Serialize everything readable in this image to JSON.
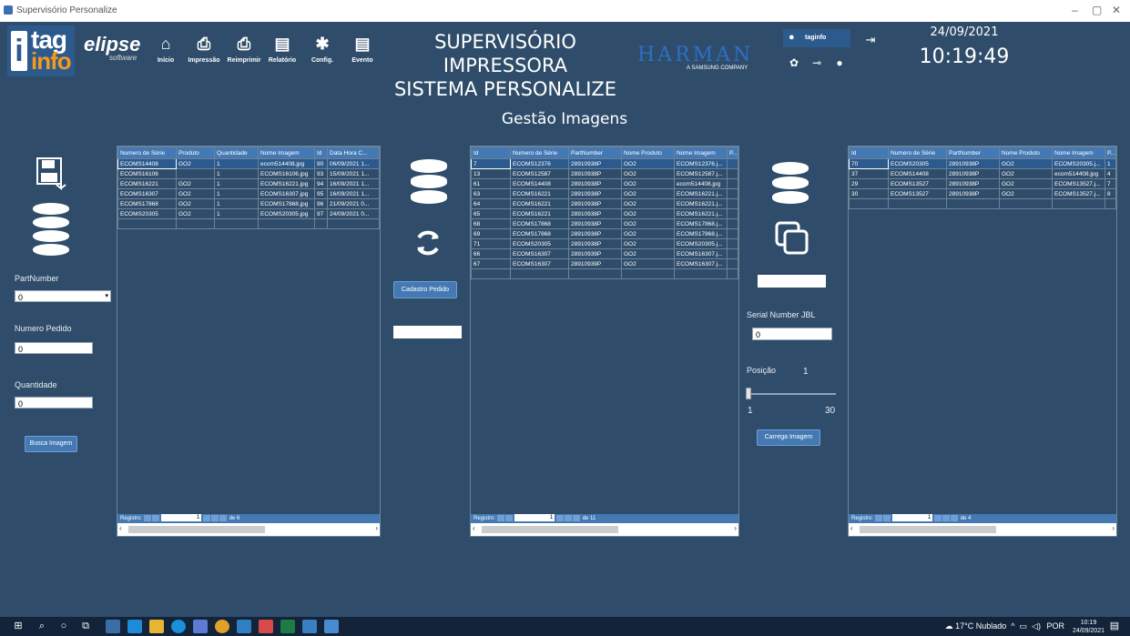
{
  "window": {
    "title": "Supervisório Personalize",
    "min": "–",
    "max": "▢",
    "close": "✕"
  },
  "nav": [
    {
      "label": "Início",
      "icon": "home-icon",
      "glyph": "⌂"
    },
    {
      "label": "Impressão",
      "icon": "printer-icon",
      "glyph": "⎙"
    },
    {
      "label": "Reimprimir",
      "icon": "reprint-icon",
      "glyph": "⎙"
    },
    {
      "label": "Relatório",
      "icon": "report-icon",
      "glyph": "▤"
    },
    {
      "label": "Config.",
      "icon": "gear-icon",
      "glyph": "✱"
    },
    {
      "label": "Evento",
      "icon": "event-icon",
      "glyph": "▤"
    }
  ],
  "logos": {
    "tag": "tag",
    "info": "info",
    "elipse": "elipse",
    "elipse_sub": "software",
    "harman": "HARMAN",
    "harman_sub": "A SAMSUNG COMPANY"
  },
  "header": {
    "title_line1": "SUPERVISÓRIO IMPRESSORA",
    "title_line2": "SISTEMA PERSONALIZE"
  },
  "user": {
    "name": "taginfo"
  },
  "datetime": {
    "date": "24/09/2021",
    "time": "10:19:49"
  },
  "page_title": "Gestão Imagens",
  "left_form": {
    "partnumber_label": "PartNumber",
    "partnumber_value": "0",
    "numero_pedido_label": "Numero Pedido",
    "numero_pedido_value": "0",
    "quantidade_label": "Quantidade",
    "quantidade_value": "0",
    "busca_button": "Busca Imagem"
  },
  "middle": {
    "cadastro_button": "Cadastro Pedido"
  },
  "right_form": {
    "serial_label": "Serial Number JBL",
    "serial_value": "0",
    "posicao_label": "Posição",
    "posicao_value": "1",
    "slider_min": "1",
    "slider_max": "30",
    "slider_value": 1,
    "carrega_button": "Carrega Imagem"
  },
  "grid1": {
    "columns": [
      "Numero de Série",
      "Produto",
      "Quantidade",
      "Nome Imagem",
      "Id",
      "Data Hora C..."
    ],
    "rows": [
      [
        "ECOMS14408",
        "GO2",
        "1",
        "ecom514408.jpg",
        "90",
        "06/09/2021 1..."
      ],
      [
        "ECOMS16106",
        "",
        "1",
        "ECOMS16106.jpg",
        "93",
        "15/09/2021 1..."
      ],
      [
        "ECOMS16221",
        "GO2",
        "1",
        "ECOMS16221.jpg",
        "94",
        "16/09/2021 1..."
      ],
      [
        "ECOMS16307",
        "GO2",
        "1",
        "ECOMS16307.jpg",
        "95",
        "16/09/2021 1..."
      ],
      [
        "ECOMS17868",
        "GO2",
        "1",
        "ECOMS17868.jpg",
        "96",
        "21/09/2021 0..."
      ],
      [
        "ECOMS20305",
        "GO2",
        "1",
        "ECOMS20305.jpg",
        "97",
        "24/09/2021 0..."
      ]
    ],
    "footer_label": "Registro:",
    "page": "1",
    "total": "de 6"
  },
  "grid2": {
    "columns": [
      "Id",
      "Numero de Série",
      "PartNumber",
      "Nome Produto",
      "Nome Imagem",
      "P..."
    ],
    "rows": [
      [
        "7",
        "ECOMS12376",
        "28910938P",
        "GO2",
        "ECOMS12376.j...",
        ""
      ],
      [
        "13",
        "ECOMS12587",
        "28910938P",
        "GO2",
        "ECOMS12587.j...",
        ""
      ],
      [
        "61",
        "ECOMS14408",
        "28910938P",
        "GO2",
        "ecom514408.jpg",
        ""
      ],
      [
        "63",
        "ECOMS16221",
        "28910938P",
        "GO2",
        "ECOMS16221.j...",
        ""
      ],
      [
        "64",
        "ECOMS16221",
        "28910938P",
        "GO2",
        "ECOMS16221.j...",
        ""
      ],
      [
        "65",
        "ECOMS16221",
        "28910938P",
        "GO2",
        "ECOMS16221.j...",
        ""
      ],
      [
        "68",
        "ECOMS17868",
        "28910938P",
        "GO2",
        "ECOMS17868.j...",
        ""
      ],
      [
        "69",
        "ECOMS17868",
        "28910938P",
        "GO2",
        "ECOMS17868.j...",
        ""
      ],
      [
        "71",
        "ECOMS20305",
        "28910938P",
        "GO2",
        "ECOMS20305.j...",
        ""
      ],
      [
        "66",
        "ECOMS16307",
        "28910939P",
        "GO2",
        "ECOMS16307.j...",
        ""
      ],
      [
        "67",
        "ECOMS16307",
        "28910939P",
        "GO2",
        "ECOMS16307.j...",
        ""
      ]
    ],
    "footer_label": "Registro:",
    "page": "1",
    "total": "de 11"
  },
  "grid3": {
    "columns": [
      "Id",
      "Numero de Série",
      "PartNumber",
      "Nome Produto",
      "Nome Imagem",
      "P..."
    ],
    "rows": [
      [
        "70",
        "ECOMS20305",
        "28910938P",
        "GO2",
        "ECOMS20305.j...",
        "1"
      ],
      [
        "37",
        "ECOMS14408",
        "28910938P",
        "GO2",
        "ecom514408.jpg",
        "4"
      ],
      [
        "29",
        "ECOMS13527",
        "28910938P",
        "GO2",
        "ECOMS13527.j...",
        "7"
      ],
      [
        "30",
        "ECOMS13527",
        "28910938P",
        "GO2",
        "ECOMS13527.j...",
        "8"
      ]
    ],
    "footer_label": "Registro:",
    "page": "1",
    "total": "de 4"
  },
  "taskbar": {
    "weather": "17°C Nublado",
    "lang": "POR",
    "clock_time": "10:19",
    "clock_date": "24/09/2021"
  },
  "colors": {
    "background": "#2f4d6a",
    "accent": "#4479b3",
    "harman": "#2b6fc7",
    "info_orange": "#f39a1e"
  }
}
